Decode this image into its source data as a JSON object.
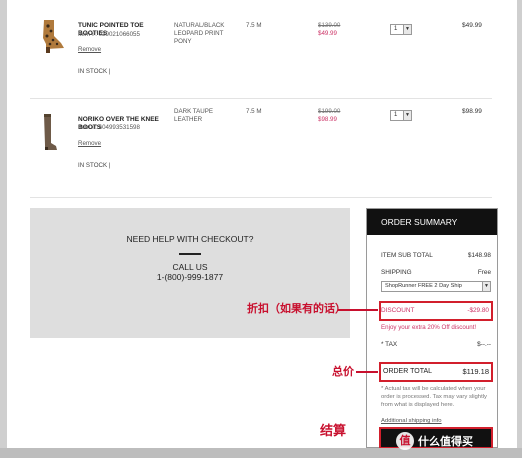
{
  "products": [
    {
      "name": "TUNIC POINTED TOE BOOTIES",
      "item_number": "Item #: 029021066055",
      "remove_label": "Remove",
      "stock": "IN STOCK  |",
      "color": "NATURAL/BLACK LEOPARD PRINT PONY",
      "size": "7.5 M",
      "original_price": "$139.00",
      "sale_price": "$49.99",
      "quantity": "1",
      "total": "$49.99"
    },
    {
      "name": "NORIKO OVER THE KNEE BOOTS",
      "item_number": "Item #: 604993531598",
      "remove_label": "Remove",
      "stock": "IN STOCK  |",
      "color": "DARK TAUPE LEATHER",
      "size": "7.5 M",
      "original_price": "$199.00",
      "sale_price": "$98.99",
      "quantity": "1",
      "total": "$98.99"
    }
  ],
  "help": {
    "title": "NEED HELP WITH CHECKOUT?",
    "call": "CALL US",
    "phone": "1-(800)-999-1877"
  },
  "summary": {
    "heading": "ORDER SUMMARY",
    "subtotal_label": "ITEM SUB TOTAL",
    "subtotal_value": "$148.98",
    "shipping_label": "SHIPPING",
    "shipping_value": "Free",
    "shipping_option": "ShopRunner FREE 2 Day Ship",
    "discount_label": "DISCOUNT",
    "discount_value": "-$29.80",
    "promo_text": "Enjoy your extra 20% Off discount!",
    "tax_label": "* TAX",
    "tax_value": "$--.--",
    "total_label": "ORDER TOTAL",
    "total_value": "$119.18",
    "tax_note": "* Actual tax will be calculated when your order is processed. Tax may vary slightly from what is displayed here.",
    "additional_shipping": "Additional shipping info"
  },
  "annotations": {
    "discount_note": "折扣（如果有的话）",
    "total_note": "总价",
    "checkout_note": "结算"
  },
  "watermark": {
    "logo_glyph": "值",
    "text": "什么值得买"
  },
  "colors": {
    "accent_red": "#c8102e",
    "sale_pink": "#cc3366",
    "summary_header": "#111111"
  }
}
